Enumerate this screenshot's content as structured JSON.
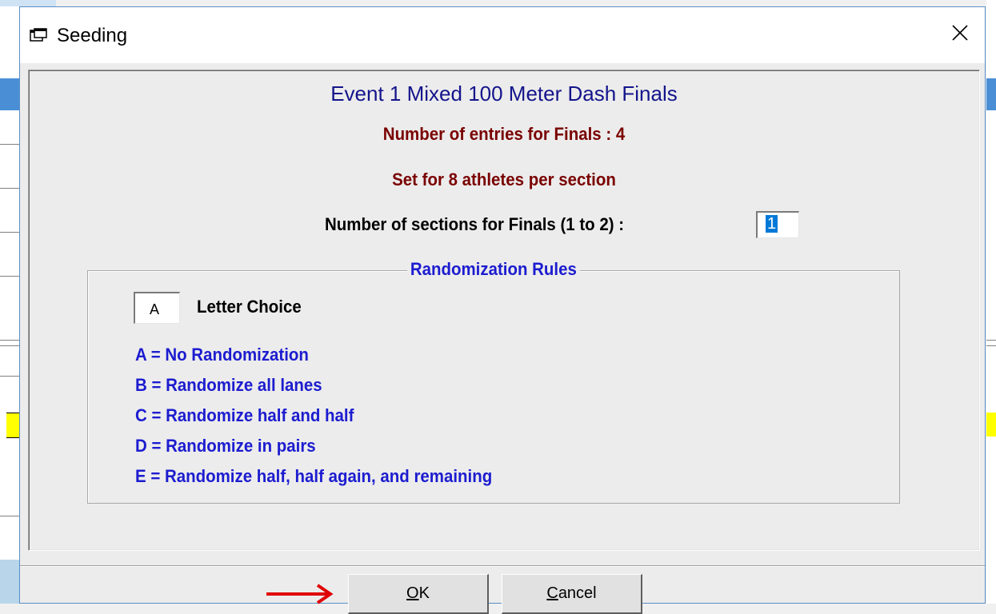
{
  "window": {
    "title": "Seeding",
    "close_glyph": "✕"
  },
  "dialog": {
    "event_title": "Event 1 Mixed 100 Meter Dash Finals",
    "entries_text": "Number of entries for Finals : 4",
    "per_section_text": "Set for 8 athletes per section",
    "sections_label": "Number of sections for Finals (1 to 2) :",
    "sections_value": "1"
  },
  "randomization": {
    "legend": "Randomization Rules",
    "letter_value": "A",
    "letter_label": "Letter Choice",
    "rules": [
      "A = No Randomization",
      "B = Randomize all lanes",
      "C = Randomize half and half",
      "D = Randomize in pairs",
      "E = Randomize half, half again, and remaining"
    ]
  },
  "buttons": {
    "ok_underline": "O",
    "ok_rest": "K",
    "cancel_underline": "C",
    "cancel_rest": "ancel"
  },
  "colors": {
    "event_title": "#14148c",
    "info_text": "#7a0000",
    "rules_text": "#1c1cd0",
    "arrow": "#e00000"
  },
  "icons": {
    "title_icon": "seeding-window-icon",
    "close": "close-icon",
    "annotation": "red-arrow-icon"
  }
}
